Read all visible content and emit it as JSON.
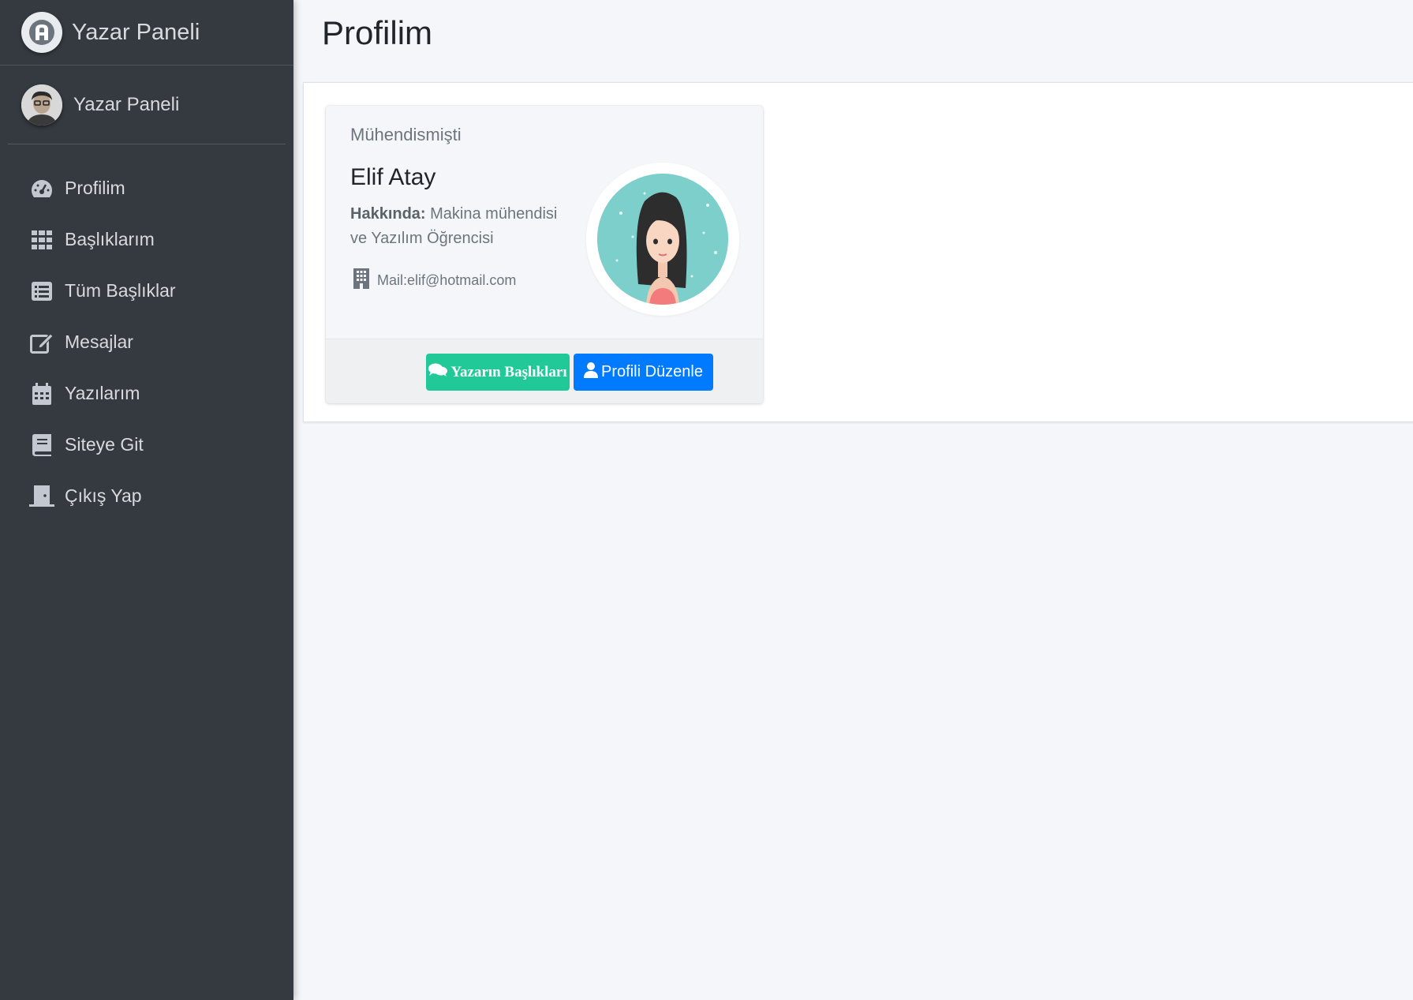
{
  "sidebar": {
    "brand_title": "Yazar Paneli",
    "user_name": "Yazar Paneli",
    "items": [
      {
        "label": "Profilim",
        "icon": "dashboard-icon"
      },
      {
        "label": "Başlıklarım",
        "icon": "grid-icon"
      },
      {
        "label": "Tüm Başlıklar",
        "icon": "list-icon"
      },
      {
        "label": "Mesajlar",
        "icon": "edit-icon"
      },
      {
        "label": "Yazılarım",
        "icon": "calendar-icon"
      },
      {
        "label": "Siteye Git",
        "icon": "book-icon"
      },
      {
        "label": "Çıkış Yap",
        "icon": "door-icon"
      }
    ]
  },
  "header": {
    "title": "Profilim"
  },
  "profile": {
    "title": "Mühendismişti",
    "name": "Elif Atay",
    "about_label": "Hakkında:",
    "about_text": " Makina mühendisi ve Yazılım Öğrencisi",
    "mail": "Mail:elif@hotmail.com",
    "buttons": {
      "posts": "Yazarın Başlıkları",
      "edit": "Profili Düzenle"
    }
  },
  "colors": {
    "sidebar_bg": "#343a40",
    "accent_green": "#20c997",
    "accent_blue": "#007bff"
  }
}
